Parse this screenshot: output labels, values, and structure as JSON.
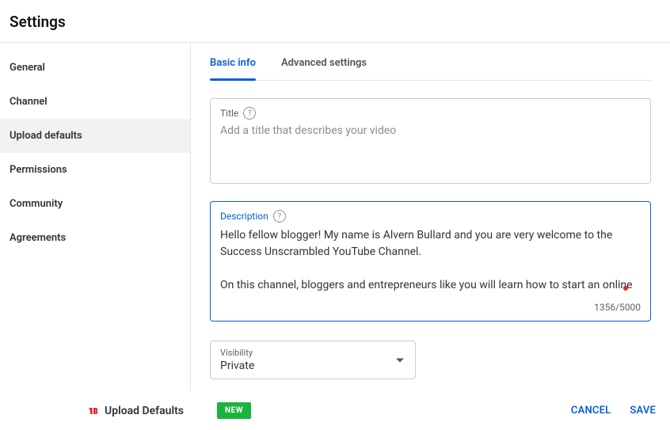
{
  "header": {
    "title": "Settings"
  },
  "sidebar": {
    "items": [
      {
        "label": "General"
      },
      {
        "label": "Channel"
      },
      {
        "label": "Upload defaults"
      },
      {
        "label": "Permissions"
      },
      {
        "label": "Community"
      },
      {
        "label": "Agreements"
      }
    ]
  },
  "tabs": [
    {
      "label": "Basic info"
    },
    {
      "label": "Advanced settings"
    }
  ],
  "title_field": {
    "label": "Title",
    "placeholder": "Add a title that describes your video",
    "value": ""
  },
  "description_field": {
    "label": "Description",
    "value": "Hello fellow blogger! My name is Alvern Bullard and you are very welcome to the Success Unscrambled YouTube Channel.\n\nOn this channel, bloggers and entrepreneurs like you will learn how to start an online business like a blog, digital marketing, Pinterest marketing, blogging, how to",
    "char_count": "1356/5000"
  },
  "visibility_field": {
    "label": "Visibility",
    "value": "Private"
  },
  "footer": {
    "brand": "Upload Defaults",
    "new_badge": "NEW",
    "cancel": "CANCEL",
    "save": "SAVE"
  }
}
